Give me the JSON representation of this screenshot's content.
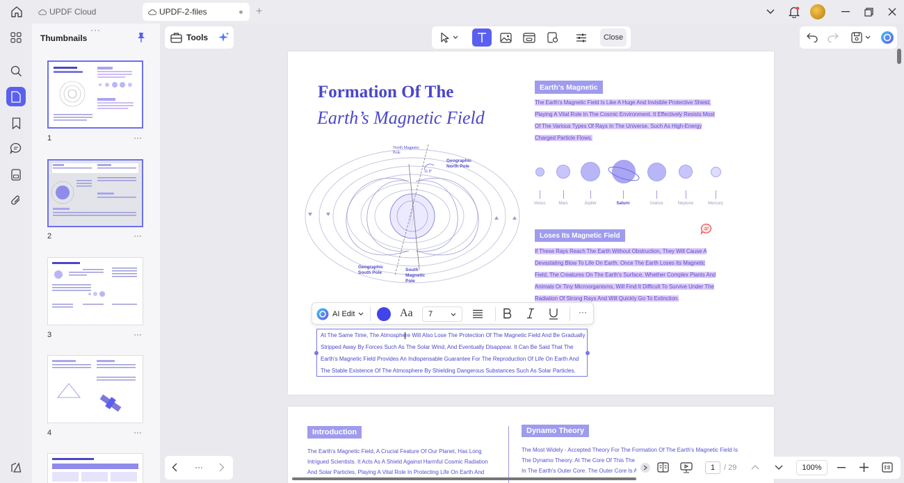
{
  "tabs": [
    {
      "label": "UPDF Cloud"
    },
    {
      "label": "UPDF-2-files"
    }
  ],
  "thumbnails": {
    "title": "Thumbnails",
    "pages": [
      "1",
      "2",
      "3",
      "4"
    ],
    "more": "···"
  },
  "toolbar": {
    "tools_label": "Tools",
    "close_label": "Close"
  },
  "page1": {
    "title_line1": "Formation Of The",
    "title_line2": "Earth’s Magnetic Field",
    "badge1": "Earth's Magnetic",
    "para1": [
      "The Earth's Magnetic Field Is Like A Huge And Invisible Protective Shield,",
      "Playing A Vital Role In The Cosmic Environment. It Effectively Resists Most",
      "Of The Various Types Of Rays In The Universe, Such As High-Energy",
      "Charged Particle Flows."
    ],
    "planets": [
      "Venus",
      "Mars",
      "Jupiter",
      "Saturn",
      "Uranus",
      "Neptune",
      "Mercury"
    ],
    "badge2": "Loses Its Magnetic Field",
    "para2": [
      "If These Rays Reach The Earth Without Obstruction, They Will Cause A",
      "Devastating Blow To Life On Earth. Once The Earth Loses Its Magnetic",
      "Field, The Creatures On The Earth's Surface, Whether Complex Plants And",
      "Animals Or Tiny Microorganisms, Will Find It Difficult To Survive Under The",
      "Radiation Of Strong Rays And Will Quickly Go To Extinction."
    ],
    "diagram": {
      "north_mag": "North Magnetic Pole",
      "geo_north": "Geographic North Pole",
      "geo_south": "Geographic South Pole",
      "south_mag": "South Magnetic Pole",
      "angle": "11.5°"
    },
    "edit_text": [
      "At The Same Time, The Atmosphere Will Also Lose The Protection Of The Magnetic Field And Be Gradually",
      "Stripped Away By Forces Such As The Solar Wind, And Eventually Disappear. It Can Be Said That The",
      "Earth's Magnetic Field Provides An Indispensable Guarantee For The Reproduction Of Life On Earth And",
      "The Stable Existence Of The Atmosphere By Shielding Dangerous Substances Such As Solar Particles."
    ]
  },
  "format_bar": {
    "ai_edit": "AI Edit",
    "font_glyph": "Aa",
    "font_size": "7",
    "more": "···"
  },
  "page2": {
    "badge1": "Introduction",
    "para1": [
      "The Earth's Magnetic Field, A Crucial Feature Of Our Planet, Has Long",
      "Intrigued Scientists. It Acts As A Shield Against Harmful Cosmic Radiation",
      "And Solar Particles, Playing A Vital Role In Protecting Life On Earth And"
    ],
    "badge2": "Dynamo Theory",
    "para2": [
      "The Most Widely - Accepted Theory For The Formation Of The Earth's Magnetic Field Is",
      "The Dynamo Theory. At The Core Of This The",
      "In The Earth's Outer Core. The Outer Core Is A"
    ]
  },
  "nav": {
    "page_current": "1",
    "page_total": "/ 29",
    "zoom": "100%",
    "dots": "···"
  },
  "colors": {
    "accent": "#5a5ff0",
    "text_blue": "#4a47c9",
    "highlight": "#d9c8f8"
  }
}
